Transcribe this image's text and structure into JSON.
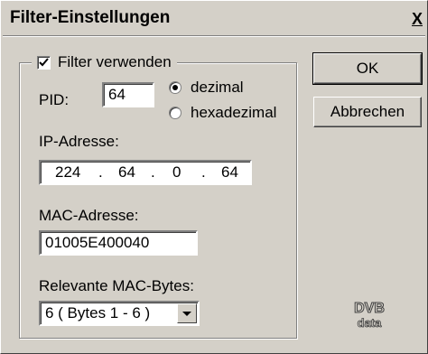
{
  "window": {
    "title": "Filter-Einstellungen",
    "close_label": "X"
  },
  "filter": {
    "enable_label": "Filter verwenden",
    "enabled": true,
    "pid": {
      "label": "PID:",
      "value": "64"
    },
    "format": {
      "options": [
        {
          "label": "dezimal",
          "selected": true
        },
        {
          "label": "hexadezimal",
          "selected": false
        }
      ]
    },
    "ip": {
      "label": "IP-Adresse:",
      "octets": [
        "224",
        "64",
        "0",
        "64"
      ],
      "separator": "."
    },
    "mac": {
      "label": "MAC-Adresse:",
      "value": "01005E400040"
    },
    "mac_bytes": {
      "label": "Relevante MAC-Bytes:",
      "selected": "6  ( Bytes 1 - 6 )"
    }
  },
  "buttons": {
    "ok": "OK",
    "cancel": "Abbrechen"
  },
  "logo": {
    "top": "DVB",
    "bottom": "data"
  },
  "colors": {
    "face": "#d4d0c8",
    "shadow": "#808080",
    "highlight": "#ffffff",
    "dark": "#404040"
  }
}
